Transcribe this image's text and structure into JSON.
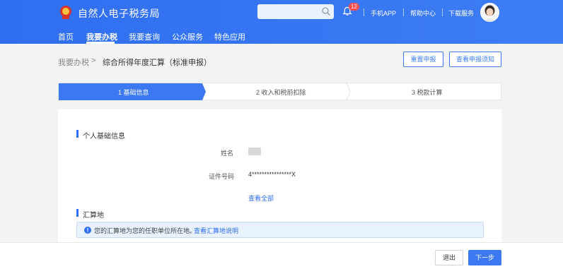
{
  "header": {
    "site_title": "自然人电子税务局",
    "search": {
      "placeholder": ""
    },
    "notification_count": "12",
    "links": [
      "手机APP",
      "帮助中心",
      "下载服务"
    ]
  },
  "nav": {
    "items": [
      "首页",
      "我要办税",
      "我要查询",
      "公众服务",
      "特色应用"
    ],
    "active": "我要办税"
  },
  "breadcrumb": {
    "parent": "我要办税",
    "separator": ">",
    "current": "综合所得年度汇算（标准申报）"
  },
  "actions": {
    "reset": "重置申报",
    "view_notice": "查看申报须知"
  },
  "steps": [
    "1 基础信息",
    "2 收入和税前扣除",
    "3 税款计算"
  ],
  "personal": {
    "section_title": "个人基础信息",
    "name_label": "姓名",
    "id_label": "证件号码",
    "id_value": "4****************X",
    "view_all": "查看全部"
  },
  "settlement": {
    "section_title": "汇算地",
    "notice_text": "您的汇算地为您的任职单位所在地。",
    "notice_link": "查看汇算地说明"
  },
  "footer": {
    "exit": "退出",
    "next": "下一步"
  },
  "colors": {
    "primary": "#2f6ef0",
    "badge": "#ff4d4f"
  }
}
